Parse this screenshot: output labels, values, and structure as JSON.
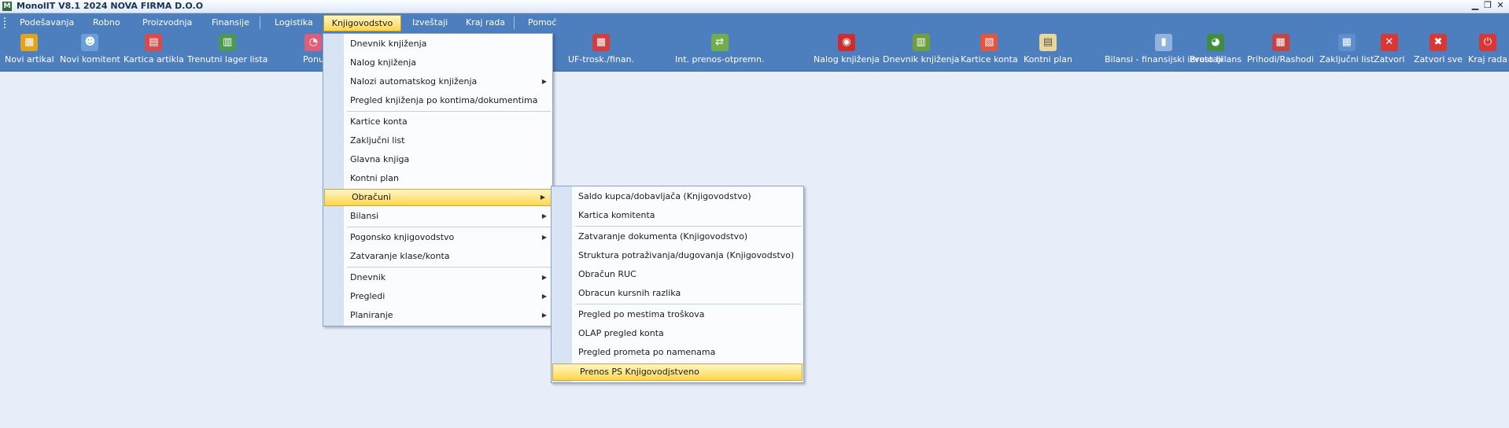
{
  "window": {
    "title": "MonolIT V8.1 2024 NOVA FIRMA D.O.O",
    "app_icon_text": "M",
    "controls": {
      "minimize": "▁",
      "restore": "❐",
      "close": "✕"
    }
  },
  "menubar": {
    "items": [
      "Podešavanja",
      "Robno",
      "Proizvodnja",
      "Finansije",
      "Logistika",
      "Knjigovodstvo",
      "Izveštaji",
      "Kraj rada",
      "Pomoć"
    ],
    "active": "Knjigovodstvo"
  },
  "toolbar": {
    "buttons": [
      {
        "label": "Novi artikal",
        "icon": "new-item-icon",
        "color": "#e2a21b",
        "glyph": "▦"
      },
      {
        "label": "Novi komitent",
        "icon": "new-client-icon",
        "color": "#6aa0d8",
        "glyph": "☻"
      },
      {
        "label": "Kartica artikla",
        "icon": "calendar-icon",
        "color": "#d94a4a",
        "glyph": "▤"
      },
      {
        "label": "Trenutni lager lista",
        "icon": "stock-list-icon",
        "color": "#4c9a52",
        "glyph": "▥"
      },
      {
        "label": "Ponu",
        "icon": "offer-icon",
        "color": "#e05e7a",
        "glyph": "◔"
      },
      {
        "label": "UF-trosk./finan.",
        "icon": "invoice-icon",
        "color": "#d53d3d",
        "glyph": "▦"
      },
      {
        "label": "Int. prenos-otpremn.",
        "icon": "transfer-icon",
        "color": "#6fae4a",
        "glyph": "⇄"
      },
      {
        "label": "Nalog knjiženja",
        "icon": "book-icon",
        "color": "#cf2c2c",
        "glyph": "◉"
      },
      {
        "label": "Dnevnik knjiženja",
        "icon": "journal-icon",
        "color": "#6e9f3f",
        "glyph": "▥"
      },
      {
        "label": "Kartice konta",
        "icon": "account-cards-icon",
        "color": "#e4553f",
        "glyph": "▧"
      },
      {
        "label": "Kontni plan",
        "icon": "chart-of-accounts-icon",
        "color": "#e9d79a",
        "glyph": "▤"
      },
      {
        "label": "Bilansi - finansijski izvestaji",
        "icon": "balance-icon",
        "color": "#8fb3de",
        "glyph": "▮"
      },
      {
        "label": "Bruto bilans",
        "icon": "pie-chart-icon",
        "color": "#3f8d3f",
        "glyph": "◕"
      },
      {
        "label": "Prihodi/Rashodi",
        "icon": "income-expense-icon",
        "color": "#c94242",
        "glyph": "▦"
      },
      {
        "label": "Zaključni list",
        "icon": "closing-sheet-icon",
        "color": "#5b8fd0",
        "glyph": "▦"
      },
      {
        "label": "Zatvori",
        "icon": "close-x-icon",
        "color": "#d93636",
        "glyph": "✕"
      },
      {
        "label": "Zatvori sve",
        "icon": "close-all-icon",
        "color": "#d93636",
        "glyph": "✖"
      },
      {
        "label": "Kraj rada",
        "icon": "power-icon",
        "color": "#d93636",
        "glyph": "⏻"
      }
    ]
  },
  "knjigovodstvo_menu": {
    "items": [
      {
        "label": "Dnevnik knjiženja",
        "submenu": false
      },
      {
        "label": "Nalog knjiženja",
        "submenu": false
      },
      {
        "label": "Nalozi automatskog knjiženja",
        "submenu": true
      },
      {
        "label": "Pregled knjiženja po kontima/dokumentima",
        "submenu": false
      },
      {
        "label": "Kartice konta",
        "submenu": false
      },
      {
        "label": "Zaključni list",
        "submenu": false
      },
      {
        "label": "Glavna knjiga",
        "submenu": false
      },
      {
        "label": "Kontni plan",
        "submenu": false
      },
      {
        "label": "Obračuni",
        "submenu": true,
        "highlighted": true
      },
      {
        "label": "Bilansi",
        "submenu": true
      },
      {
        "label": "Pogonsko knjigovodstvo",
        "submenu": true
      },
      {
        "label": "Zatvaranje klase/konta",
        "submenu": false
      },
      {
        "label": "Dnevnik",
        "submenu": true
      },
      {
        "label": "Pregledi",
        "submenu": true
      },
      {
        "label": "Planiranje",
        "submenu": true
      }
    ]
  },
  "obracuni_menu": {
    "items": [
      {
        "label": "Saldo kupca/dobavljača (Knjigovodstvo)"
      },
      {
        "label": "Kartica komitenta"
      },
      {
        "label": "Zatvaranje dokumenta (Knjigovodstvo)"
      },
      {
        "label": "Struktura potraživanja/dugovanja (Knjigovodstvo)"
      },
      {
        "label": "Obračun RUC"
      },
      {
        "label": "Obracun kursnih razlika"
      },
      {
        "label": "Pregled po mestima troškova"
      },
      {
        "label": "OLAP pregled konta"
      },
      {
        "label": "Pregled prometa po namenama"
      },
      {
        "label": "Prenos PS Knjigovodjstveno",
        "highlighted": true
      }
    ]
  },
  "colors": {
    "toolbar_bg": "#4d7ebd",
    "workspace_bg": "#e7eef9",
    "highlight": "#ffd64f"
  }
}
